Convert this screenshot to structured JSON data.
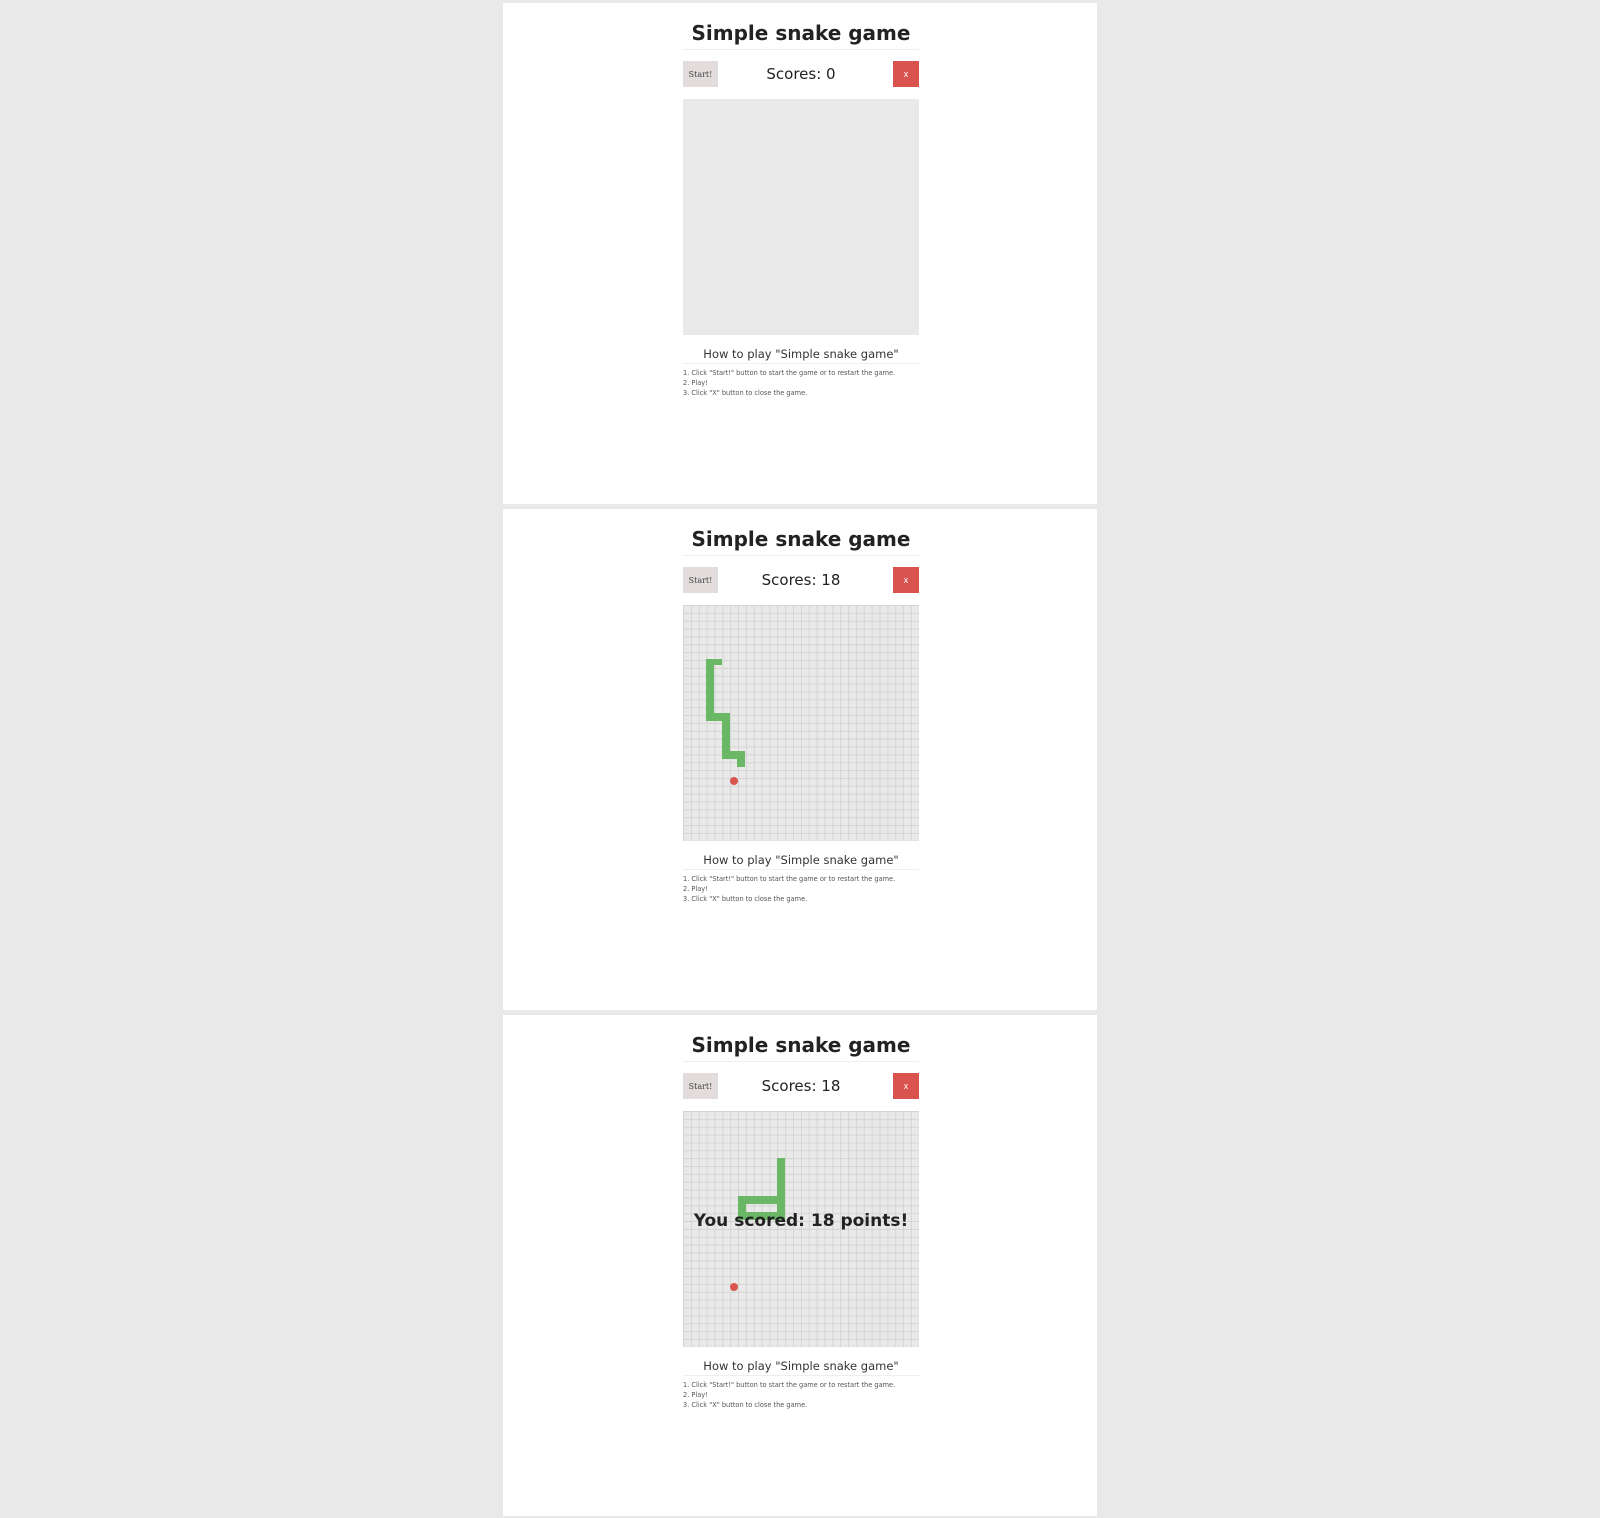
{
  "colors": {
    "close_button": "#d9534f",
    "start_button": "#e3dcdc",
    "snake": "#6ab865",
    "food": "#d9534f",
    "board": "#e9e9e9"
  },
  "frames": [
    {
      "title": "Simple snake game",
      "start_label": "Start!",
      "score_text": "Scores: 0",
      "close_label": "x",
      "board_grid": false,
      "game_over_message": "",
      "howto_title": "How to play \"Simple snake game\"",
      "steps": [
        "1. Click \"Start!\" button to start the game or to restart the game.",
        "2. Play!",
        "3. Click \"X\" button to close the game."
      ]
    },
    {
      "title": "Simple snake game",
      "start_label": "Start!",
      "score_text": "Scores: 18",
      "close_label": "x",
      "board_grid": true,
      "game_over_message": "",
      "howto_title": "How to play \"Simple snake game\"",
      "steps": [
        "1. Click \"Start!\" button to start the game or to restart the game.",
        "2. Play!",
        "3. Click \"X\" button to close the game."
      ]
    },
    {
      "title": "Simple snake game",
      "start_label": "Start!",
      "score_text": "Scores: 18",
      "close_label": "x",
      "board_grid": true,
      "game_over_message": "You scored: 18 points!",
      "howto_title": "How to play \"Simple snake game\"",
      "steps": [
        "1. Click \"Start!\" button to start the game or to restart the game.",
        "2. Play!",
        "3. Click \"X\" button to close the game."
      ]
    }
  ]
}
